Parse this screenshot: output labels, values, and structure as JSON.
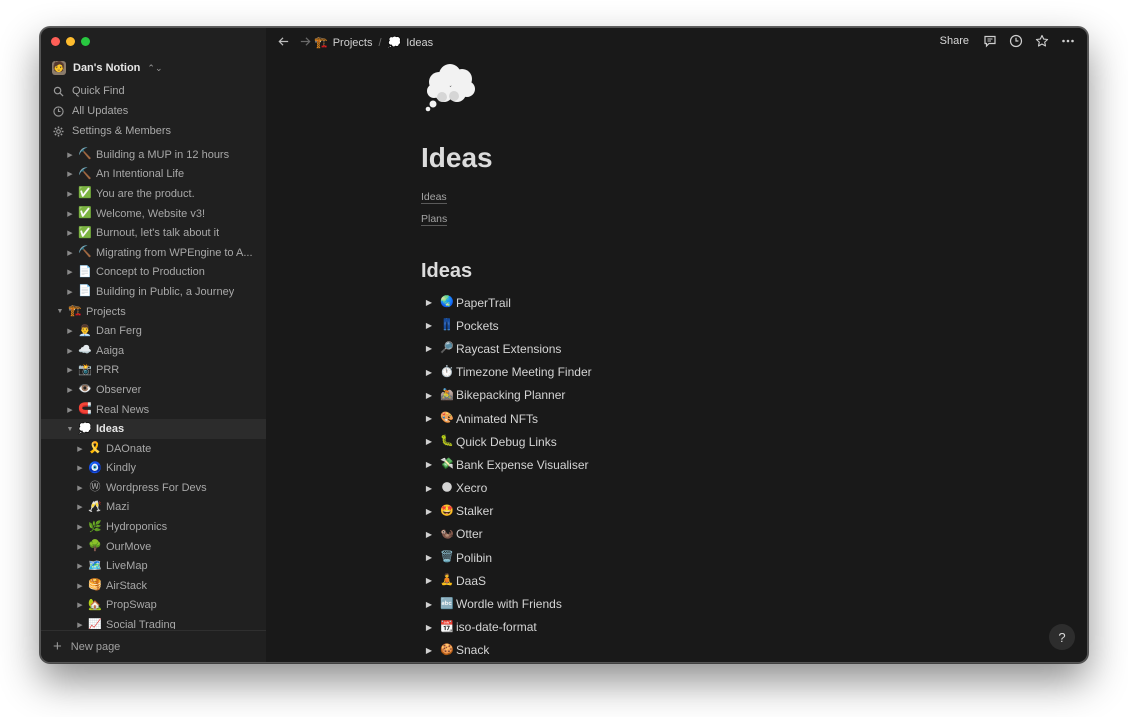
{
  "workspace": {
    "name": "Dan's Notion",
    "avatar": "🧑"
  },
  "sidebar": {
    "menu": [
      {
        "label": "Quick Find",
        "icon": "search-icon"
      },
      {
        "label": "All Updates",
        "icon": "clock-icon"
      },
      {
        "label": "Settings & Members",
        "icon": "gear-icon"
      }
    ],
    "tree": [
      {
        "label": "Building a MUP in 12 hours",
        "icon": "⛏️",
        "depth": 1,
        "expanded": false,
        "selected": false
      },
      {
        "label": "An Intentional Life",
        "icon": "⛏️",
        "depth": 1,
        "expanded": false,
        "selected": false
      },
      {
        "label": "You are the product.",
        "icon": "✅",
        "depth": 1,
        "expanded": false,
        "selected": false
      },
      {
        "label": "Welcome, Website v3!",
        "icon": "✅",
        "depth": 1,
        "expanded": false,
        "selected": false
      },
      {
        "label": "Burnout, let's talk about it",
        "icon": "✅",
        "depth": 1,
        "expanded": false,
        "selected": false
      },
      {
        "label": "Migrating from WPEngine to A...",
        "icon": "⛏️",
        "depth": 1,
        "expanded": false,
        "selected": false
      },
      {
        "label": "Concept to Production",
        "icon": "📄",
        "depth": 1,
        "expanded": false,
        "selected": false
      },
      {
        "label": "Building in Public, a Journey",
        "icon": "📄",
        "depth": 1,
        "expanded": false,
        "selected": false
      },
      {
        "label": "Projects",
        "icon": "🏗️",
        "depth": 0,
        "expanded": true,
        "selected": false
      },
      {
        "label": "Dan Ferg",
        "icon": "👨‍💼",
        "depth": 1,
        "expanded": false,
        "selected": false
      },
      {
        "label": "Aaiga",
        "icon": "☁️",
        "depth": 1,
        "expanded": false,
        "selected": false
      },
      {
        "label": "PRR",
        "icon": "📸",
        "depth": 1,
        "expanded": false,
        "selected": false
      },
      {
        "label": "Observer",
        "icon": "👁️",
        "depth": 1,
        "expanded": false,
        "selected": false
      },
      {
        "label": "Real News",
        "icon": "🧲",
        "depth": 1,
        "expanded": false,
        "selected": false
      },
      {
        "label": "Ideas",
        "icon": "💭",
        "depth": 1,
        "expanded": true,
        "selected": true
      },
      {
        "label": "DAOnate",
        "icon": "🎗️",
        "depth": 2,
        "expanded": false,
        "selected": false
      },
      {
        "label": "Kindly",
        "icon": "🧿",
        "depth": 2,
        "expanded": false,
        "selected": false
      },
      {
        "label": "Wordpress For Devs",
        "icon": "Ⓦ",
        "depth": 2,
        "expanded": false,
        "selected": false
      },
      {
        "label": "Mazi",
        "icon": "🥂",
        "depth": 2,
        "expanded": false,
        "selected": false
      },
      {
        "label": "Hydroponics",
        "icon": "🌿",
        "depth": 2,
        "expanded": false,
        "selected": false
      },
      {
        "label": "OurMove",
        "icon": "🌳",
        "depth": 2,
        "expanded": false,
        "selected": false
      },
      {
        "label": "LiveMap",
        "icon": "🗺️",
        "depth": 2,
        "expanded": false,
        "selected": false
      },
      {
        "label": "AirStack",
        "icon": "🥞",
        "depth": 2,
        "expanded": false,
        "selected": false
      },
      {
        "label": "PropSwap",
        "icon": "🏡",
        "depth": 2,
        "expanded": false,
        "selected": false
      },
      {
        "label": "Social Trading",
        "icon": "📈",
        "depth": 2,
        "expanded": false,
        "selected": false
      }
    ],
    "new_page_label": "New page"
  },
  "topbar": {
    "breadcrumb": [
      {
        "label": "Projects",
        "icon": "🏗️"
      },
      {
        "label": "Ideas",
        "icon": "💭"
      }
    ],
    "share_label": "Share"
  },
  "page": {
    "icon": "thought-balloon-icon",
    "title": "Ideas",
    "links": [
      "Ideas",
      "Plans"
    ],
    "section_heading": "Ideas",
    "toggles": [
      {
        "label": "PaperTrail",
        "icon": "🌏"
      },
      {
        "label": "Pockets",
        "icon": "👖"
      },
      {
        "label": "Raycast Extensions",
        "icon": "🔎"
      },
      {
        "label": "Timezone Meeting Finder",
        "icon": "⏱️"
      },
      {
        "label": "Bikepacking Planner",
        "icon": "🚵"
      },
      {
        "label": "Animated NFTs",
        "icon": "🎨"
      },
      {
        "label": "Quick Debug Links",
        "icon": "🐛"
      },
      {
        "label": "Bank Expense Visualiser",
        "icon": "💸"
      },
      {
        "label": "Xecro",
        "icon": "🌑"
      },
      {
        "label": "Stalker",
        "icon": "🤩"
      },
      {
        "label": "Otter",
        "icon": "🦦"
      },
      {
        "label": "Polibin",
        "icon": "🗑️"
      },
      {
        "label": "DaaS",
        "icon": "🧘"
      },
      {
        "label": "Wordle with Friends",
        "icon": "🔤"
      },
      {
        "label": "iso-date-format",
        "icon": "📆"
      },
      {
        "label": "Snack",
        "icon": "🍪"
      }
    ]
  },
  "help_label": "?",
  "colors": {
    "window_bg": "#191919",
    "sidebar_bg": "#202020",
    "selected_row_bg": "#2c2c2c",
    "text_primary": "#d4d4d4",
    "text_muted": "#a5a5a5"
  }
}
